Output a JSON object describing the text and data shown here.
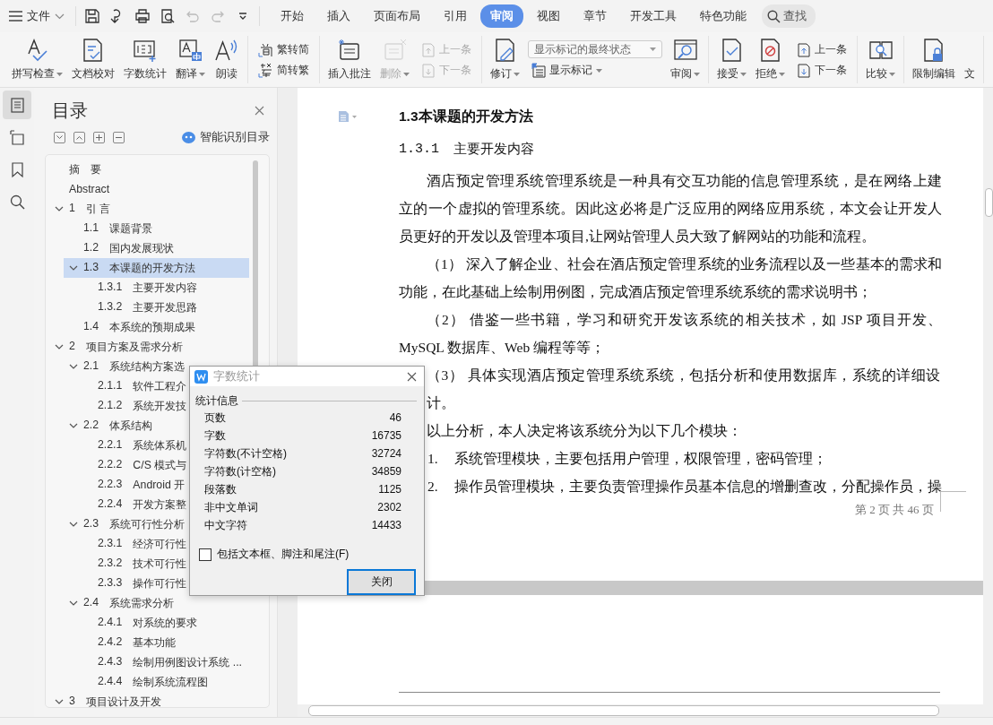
{
  "menu": {
    "label": "文件"
  },
  "quick_access": [
    {
      "disabled": false
    },
    {
      "disabled": false
    },
    {
      "disabled": false
    },
    {
      "disabled": false
    },
    {
      "disabled": true
    },
    {
      "disabled": true
    },
    {
      "disabled": false
    }
  ],
  "tabs": [
    {
      "label": "开始",
      "selected": false
    },
    {
      "label": "插入",
      "selected": false
    },
    {
      "label": "页面布局",
      "selected": false
    },
    {
      "label": "引用",
      "selected": false
    },
    {
      "label": "审阅",
      "selected": true
    },
    {
      "label": "视图",
      "selected": false
    },
    {
      "label": "章节",
      "selected": false
    },
    {
      "label": "开发工具",
      "selected": false
    },
    {
      "label": "特色功能",
      "selected": false
    }
  ],
  "search": {
    "label": "查找"
  },
  "ribbon": [
    {
      "items": [
        {
          "kind": "large",
          "label": "拼写检查",
          "dropdown": true,
          "disabled": false
        },
        {
          "kind": "large",
          "label": "文档校对",
          "dropdown": false,
          "disabled": false
        },
        {
          "kind": "large",
          "label": "字数统计",
          "dropdown": false,
          "disabled": false
        },
        {
          "kind": "large",
          "label": "翻译",
          "dropdown": true,
          "disabled": false
        },
        {
          "kind": "large",
          "label": "朗读",
          "dropdown": false,
          "disabled": false
        }
      ]
    },
    {
      "items": [
        {
          "kind": "stack",
          "rows": [
            {
              "kind": "small",
              "label": "繁转简",
              "dropdown": false,
              "disabled": false
            },
            {
              "kind": "small",
              "label": "简转繁",
              "dropdown": false,
              "disabled": false
            }
          ]
        }
      ]
    },
    {
      "items": [
        {
          "kind": "large",
          "label": "插入批注",
          "dropdown": false,
          "disabled": false
        },
        {
          "kind": "large",
          "label": "删除",
          "dropdown": true,
          "disabled": true
        },
        {
          "kind": "stack",
          "rows": [
            {
              "kind": "small",
              "label": "上一条",
              "dropdown": false,
              "disabled": true
            },
            {
              "kind": "small",
              "label": "下一条",
              "dropdown": false,
              "disabled": true
            }
          ]
        }
      ]
    },
    {
      "items": [
        {
          "kind": "large",
          "label": "修订",
          "dropdown": true,
          "disabled": false
        },
        {
          "kind": "stack",
          "rows": [
            {
              "kind": "select",
              "value": "显示标记的最终状态"
            },
            {
              "kind": "small",
              "label": "显示标记",
              "dropdown": true,
              "disabled": false
            }
          ]
        },
        {
          "kind": "large",
          "label": "审阅",
          "dropdown": true,
          "disabled": false
        }
      ]
    },
    {
      "items": [
        {
          "kind": "large",
          "label": "接受",
          "dropdown": true,
          "disabled": false
        },
        {
          "kind": "large",
          "label": "拒绝",
          "dropdown": true,
          "disabled": false
        },
        {
          "kind": "stack",
          "rows": [
            {
              "kind": "small",
              "label": "上一条",
              "dropdown": false,
              "disabled": false
            },
            {
              "kind": "small",
              "label": "下一条",
              "dropdown": false,
              "disabled": false
            }
          ]
        }
      ]
    },
    {
      "items": [
        {
          "kind": "large",
          "label": "比较",
          "dropdown": true,
          "disabled": false
        }
      ]
    },
    {
      "items": [
        {
          "kind": "large",
          "label": "限制编辑",
          "dropdown": false,
          "disabled": false
        },
        {
          "kind": "large",
          "label": "文",
          "dropdown": false,
          "disabled": false
        }
      ]
    }
  ],
  "side_tools": [
    {
      "selected": true
    },
    {
      "selected": false
    },
    {
      "selected": false
    },
    {
      "selected": false
    }
  ],
  "toc": {
    "title": "目录",
    "smart_button": "智能识别目录",
    "items": [
      {
        "title": "摘　要",
        "selected": false
      },
      {
        "title": "Abstract",
        "selected": false
      },
      {
        "number": "1",
        "title": "引 言",
        "selected": false,
        "expanded": true,
        "children": [
          {
            "number": "1.1",
            "title": "课题背景",
            "selected": false
          },
          {
            "number": "1.2",
            "title": "国内发展现状",
            "selected": false
          },
          {
            "number": "1.3",
            "title": "本课题的开发方法",
            "selected": true,
            "expanded": true,
            "children": [
              {
                "number": "1.3.1",
                "title": "主要开发内容",
                "selected": false
              },
              {
                "number": "1.3.2",
                "title": "主要开发思路",
                "selected": false
              }
            ]
          },
          {
            "number": "1.4",
            "title": "本系统的预期成果",
            "selected": false
          }
        ]
      },
      {
        "number": "2",
        "title": "项目方案及需求分析",
        "selected": false,
        "expanded": true,
        "children": [
          {
            "number": "2.1",
            "title": "系统结构方案选",
            "selected": false,
            "expanded": true,
            "children": [
              {
                "number": "2.1.1",
                "title": "软件工程介",
                "selected": false
              },
              {
                "number": "2.1.2",
                "title": "系统开发技",
                "selected": false
              }
            ]
          },
          {
            "number": "2.2",
            "title": "体系结构",
            "selected": false,
            "expanded": true,
            "children": [
              {
                "number": "2.2.1",
                "title": "系统体系机",
                "selected": false
              },
              {
                "number": "2.2.2",
                "title": "C/S 模式与",
                "selected": false
              },
              {
                "number": "2.2.3",
                "title": "Android 开",
                "selected": false
              },
              {
                "number": "2.2.4",
                "title": "开发方案整",
                "selected": false
              }
            ]
          },
          {
            "number": "2.3",
            "title": "系统可行性分析",
            "selected": false,
            "expanded": true,
            "children": [
              {
                "number": "2.3.1",
                "title": "经济可行性",
                "selected": false
              },
              {
                "number": "2.3.2",
                "title": "技术可行性",
                "selected": false
              },
              {
                "number": "2.3.3",
                "title": "操作可行性",
                "selected": false
              }
            ]
          },
          {
            "number": "2.4",
            "title": "系统需求分析",
            "selected": false,
            "expanded": true,
            "children": [
              {
                "number": "2.4.1",
                "title": "对系统的要求",
                "selected": false
              },
              {
                "number": "2.4.2",
                "title": "基本功能",
                "selected": false
              },
              {
                "number": "2.4.3",
                "title": "绘制用例图设计系统 ...",
                "selected": false
              },
              {
                "number": "2.4.4",
                "title": "绘制系统流程图",
                "selected": false
              }
            ]
          }
        ]
      },
      {
        "number": "3",
        "title": "项目设计及开发",
        "selected": false,
        "expanded": true
      }
    ]
  },
  "document": {
    "heading": "1.3本课题的开发方法",
    "subheading": {
      "number": "1.3.1",
      "title": "主要开发内容"
    },
    "paragraphs": [
      "酒店预定管理系统管理系统是一种具有交互功能的信息管理系统，是在网络上建立的一个虚拟的管理系统。因此这必将是广泛应用的网络应用系统，本文会让开发人员更好的开发以及管理本项目,让网站管理人员大致了解网站的功能和流程。",
      "（1） 深入了解企业、社会在酒店预定管理系统的业务流程以及一些基本的需求和功能，在此基础上绘制用例图，完成酒店预定管理系统系统的需求说明书；",
      "（2） 借鉴一些书籍，学习和研究开发该系统的相关技术，如 JSP 项目开发、MySQL 数据库、Web 编程等等；",
      "（3） 具体实现酒店预定管理系统系统，包括分析和使用数据库，系统的详细设计。",
      "以上分析，本人决定将该系统分为以下几个模块："
    ],
    "list": [
      {
        "marker": "1.",
        "text": "系统管理模块，主要包括用户管理，权限管理，密码管理；"
      },
      {
        "marker": "2.",
        "text": "操作员管理模块，主要负责管理操作员基本信息的增删查改，分配操作员，操"
      }
    ],
    "page_footer": "第 2 页 共 46 页"
  },
  "dialog": {
    "title": "字数统计",
    "group": "统计信息",
    "stats": [
      {
        "label": "页数",
        "value": "46"
      },
      {
        "label": "字数",
        "value": "16735"
      },
      {
        "label": "字符数(不计空格)",
        "value": "32724"
      },
      {
        "label": "字符数(计空格)",
        "value": "34859"
      },
      {
        "label": "段落数",
        "value": "1125"
      },
      {
        "label": "非中文单词",
        "value": "2302"
      },
      {
        "label": "中文字符",
        "value": "14433"
      }
    ],
    "option": {
      "label": "包括文本框、脚注和尾注(F)",
      "checked": false
    },
    "button": "关闭"
  }
}
